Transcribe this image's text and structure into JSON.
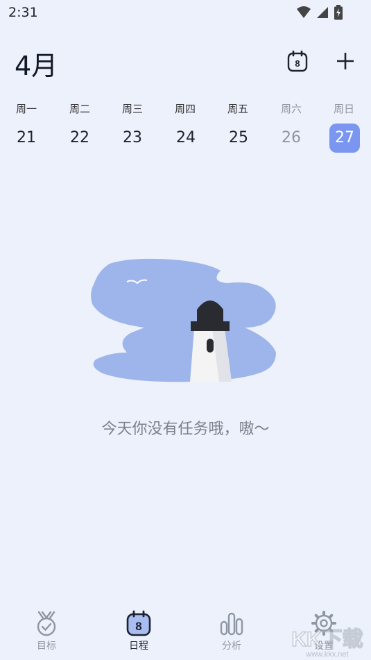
{
  "status_bar": {
    "time": "2:31",
    "icons": [
      "wifi-icon",
      "signal-icon",
      "battery-charging-icon"
    ]
  },
  "header": {
    "month": "4月",
    "today_badge": "8"
  },
  "week": {
    "days": [
      {
        "label": "周一",
        "date": "21",
        "state": "normal"
      },
      {
        "label": "周二",
        "date": "22",
        "state": "normal"
      },
      {
        "label": "周三",
        "date": "23",
        "state": "normal"
      },
      {
        "label": "周四",
        "date": "24",
        "state": "normal"
      },
      {
        "label": "周五",
        "date": "25",
        "state": "normal"
      },
      {
        "label": "周六",
        "date": "26",
        "state": "muted"
      },
      {
        "label": "周日",
        "date": "27",
        "state": "selected"
      }
    ]
  },
  "empty_state": {
    "message": "今天你没有任务哦，嗷～"
  },
  "bottom_nav": {
    "items": [
      {
        "label": "目标",
        "icon": "medal-check-icon",
        "active": false
      },
      {
        "label": "日程",
        "icon": "calendar-icon",
        "badge": "8",
        "active": true
      },
      {
        "label": "分析",
        "icon": "bar-chart-icon",
        "active": false
      },
      {
        "label": "设置",
        "icon": "gear-icon",
        "active": false
      }
    ]
  },
  "watermark": {
    "text": "KK下载",
    "url_text": "www.kkx.net"
  },
  "colors": {
    "background": "#ECF1FB",
    "accent": "#7A96F0",
    "illustration": "#9DB5EA"
  }
}
